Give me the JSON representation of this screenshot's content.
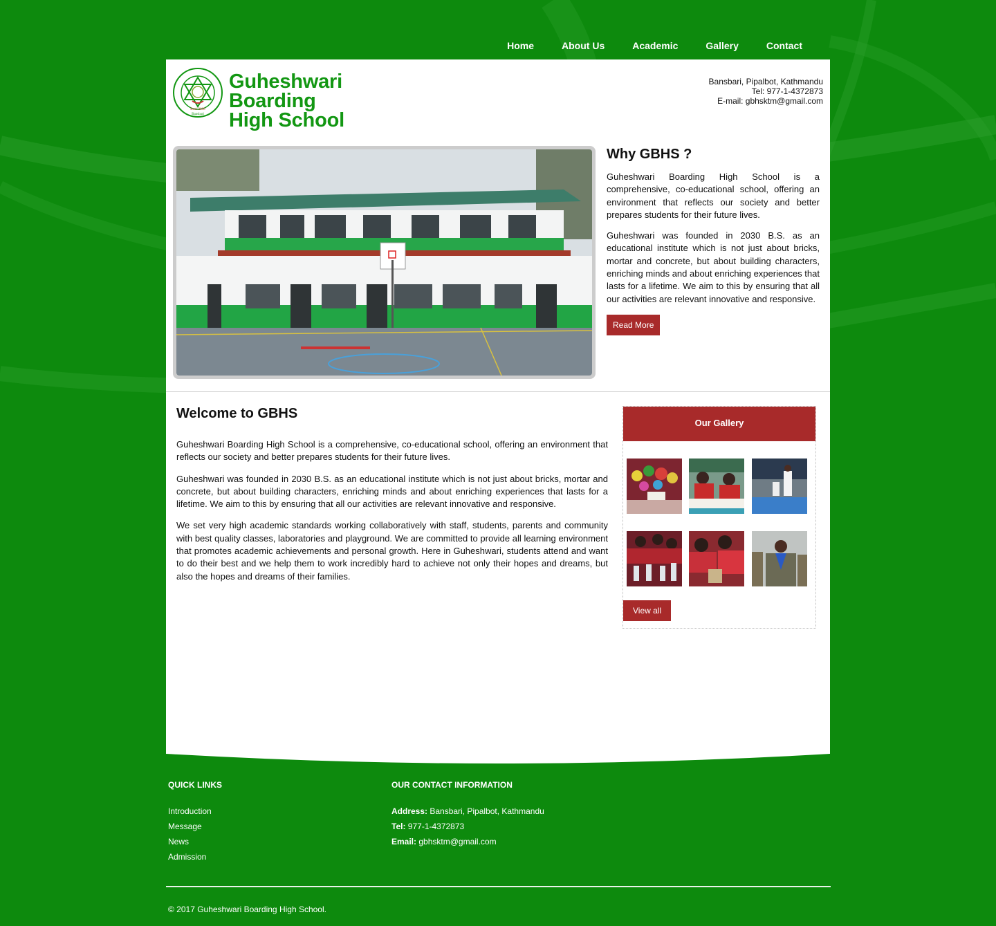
{
  "nav": {
    "items": [
      {
        "label": "Home"
      },
      {
        "label": "About Us"
      },
      {
        "label": "Academic"
      },
      {
        "label": "Gallery"
      },
      {
        "label": "Contact"
      }
    ]
  },
  "header": {
    "logo_line1": "Guheshwari Boarding",
    "logo_line2": "High School",
    "seal_text": "Guheshwari Boarding High School",
    "seal_est": "Estd. 2030",
    "seal_place": "Bansbari",
    "address": "Bansbari, Pipalbot, Kathmandu",
    "tel": "Tel: 977-1-4372873",
    "email": "E-mail: gbhsktm@gmail.com"
  },
  "why": {
    "title": "Why GBHS ?",
    "p1": "Guheshwari Boarding High School is a comprehensive, co-educational school, offering an environment that reflects our society and better prepares students for their future lives.",
    "p2": "Guheshwari was founded in 2030 B.S. as an educational institute which is not just about bricks, mortar and concrete, but about building characters, enriching minds and about enriching experiences that lasts for a lifetime. We aim to this by ensuring that all our activities are relevant innovative and responsive.",
    "button": "Read More"
  },
  "welcome": {
    "title": "Welcome to GBHS",
    "p1": "Guheshwari Boarding High School is a comprehensive, co-educational school, offering an environment that reflects our society and better prepares students for their future lives.",
    "p2": "Guheshwari was founded in 2030 B.S. as an educational institute which is not just about bricks, mortar and concrete, but about building characters, enriching minds and about enriching experiences that lasts for a lifetime. We aim to this by ensuring that all our activities are relevant innovative and responsive.",
    "p3": "We set very high academic standards working collaboratively with staff, students, parents and community with best quality classes, laboratories and playground. We are committed to provide all learning environment that promotes academic achievements and personal growth. Here in Guheshwari, students attend and want to do their best and we help them to work incredibly hard to achieve not only their hopes and dreams, but also the hopes and dreams of their families."
  },
  "gallery": {
    "title": "Our Gallery",
    "button": "View all"
  },
  "footer": {
    "quick_links_title": "QUICK LINKS",
    "links": [
      {
        "label": "Introduction"
      },
      {
        "label": "Message"
      },
      {
        "label": "News"
      },
      {
        "label": "Admission"
      }
    ],
    "contact_title": "OUR CONTACT INFORMATION",
    "address_label": "Address:",
    "address": "Bansbari, Pipalbot, Kathmandu",
    "tel_label": "Tel:",
    "tel": "977-1-4372873",
    "email_label": "Email:",
    "email": "gbhsktm@gmail.com",
    "copyright": "© 2017 Guheshwari Boarding High School."
  },
  "colors": {
    "background_green": "#0d8a0d",
    "brand_green": "#139713",
    "accent_red": "#a82a2a"
  }
}
